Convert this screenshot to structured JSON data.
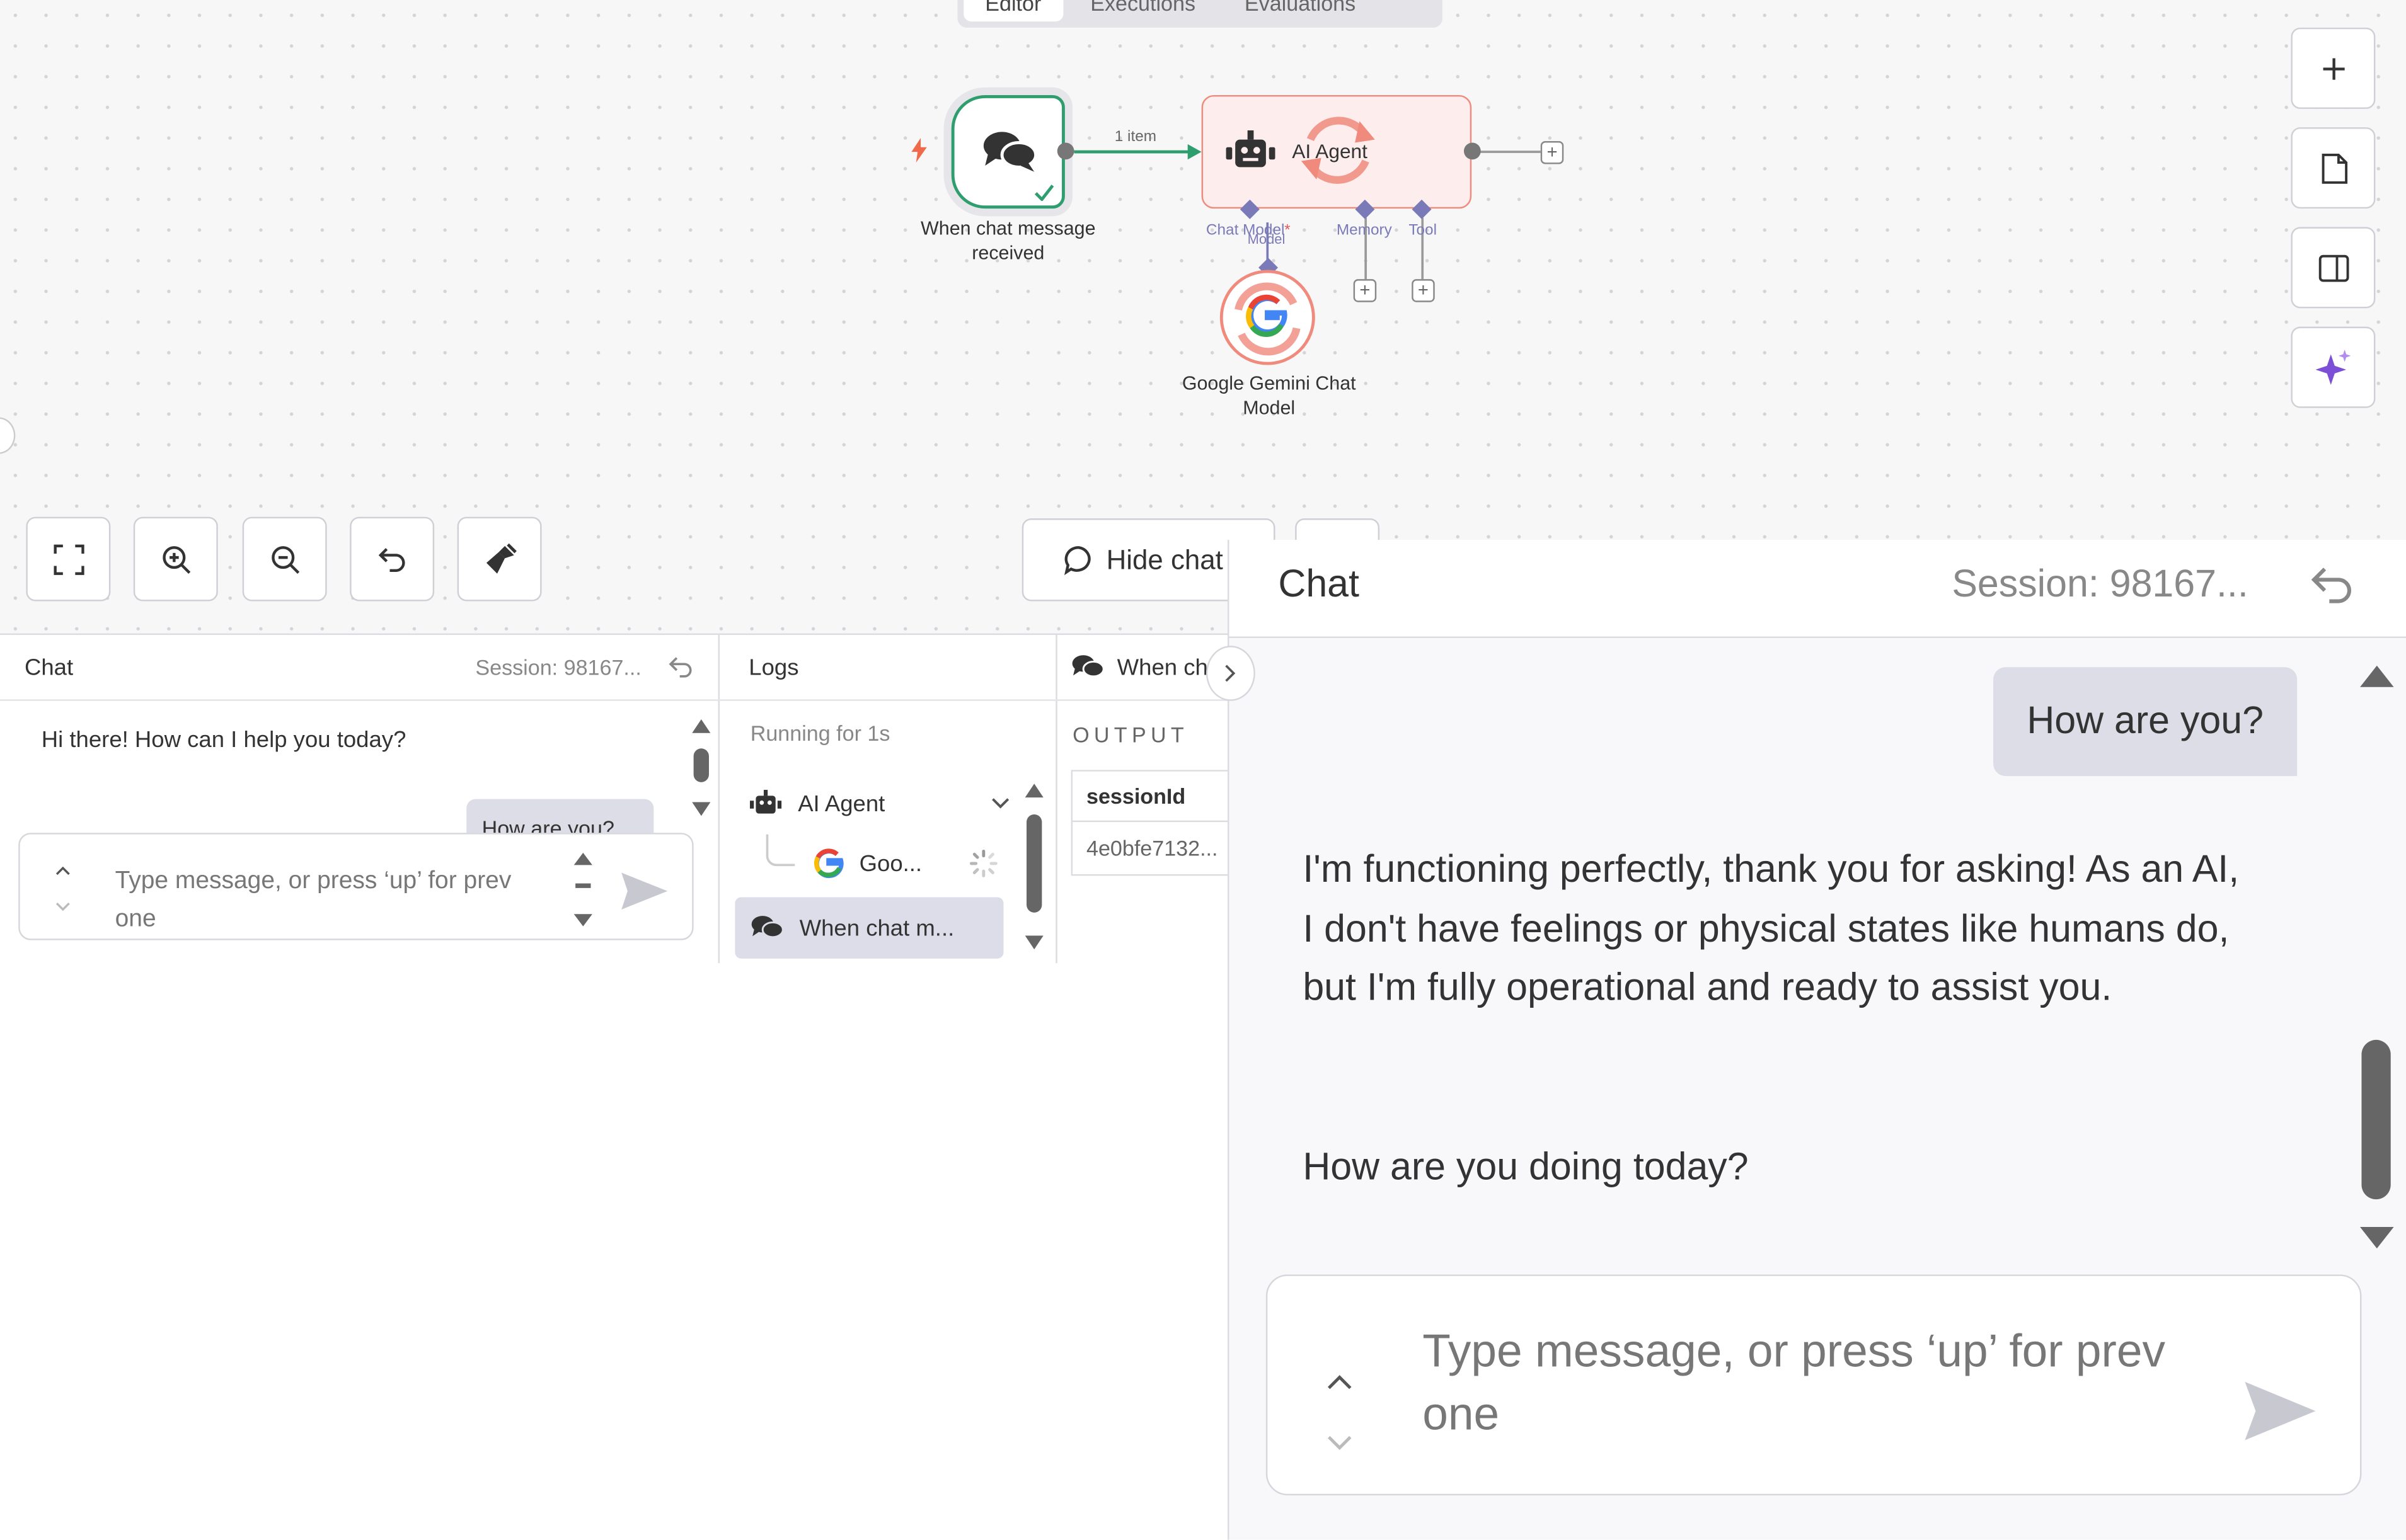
{
  "canvas": {
    "tabs": [
      "Editor",
      "Executions",
      "Evaluations"
    ],
    "trigger_node": {
      "label": "When chat message received"
    },
    "connection_label": "1 item",
    "agent_node": {
      "label": "AI Agent"
    },
    "ports": {
      "chat_model": "Chat Model",
      "model": "Model",
      "memory": "Memory",
      "tool": "Tool"
    },
    "gemini_node": {
      "label": "Google Gemini Chat Model"
    },
    "hide_chat_label": "Hide chat"
  },
  "chat_small": {
    "title": "Chat",
    "session": "Session: 98167...",
    "greeting": "Hi there! How can I help you today?",
    "user_message_partial": "How are you?",
    "input_placeholder": "Type message, or press ‘up’ for prev one"
  },
  "logs": {
    "title": "Logs",
    "status": "Running for 1s",
    "items": [
      {
        "label": "AI Agent"
      },
      {
        "label": "Goo..."
      },
      {
        "label": "When chat m..."
      }
    ]
  },
  "output_panel": {
    "node_title": "When chat message received",
    "section_label": "OUTPUT",
    "column_header": "sessionId",
    "cell_value": "4e0bfe7132..."
  },
  "chat_large": {
    "title": "Chat",
    "session": "Session: 98167...",
    "user_message": "How are you?",
    "bot_message_p1": "I'm functioning perfectly, thank you for asking! As an AI, I don't have feelings or physical states like humans do, but I'm fully operational and ready to assist you.",
    "bot_message_p2": "How are you doing today?",
    "input_placeholder": "Type message, or press ‘up’ for prev one"
  },
  "colors": {
    "trigger_border": "#2f9e6e",
    "agent_border": "#f08a7d",
    "agent_fill": "#fdeeed",
    "port_accent": "#7a7ab8",
    "user_bubble": "#dcdde6",
    "selected_log_item": "#dcdde8"
  }
}
